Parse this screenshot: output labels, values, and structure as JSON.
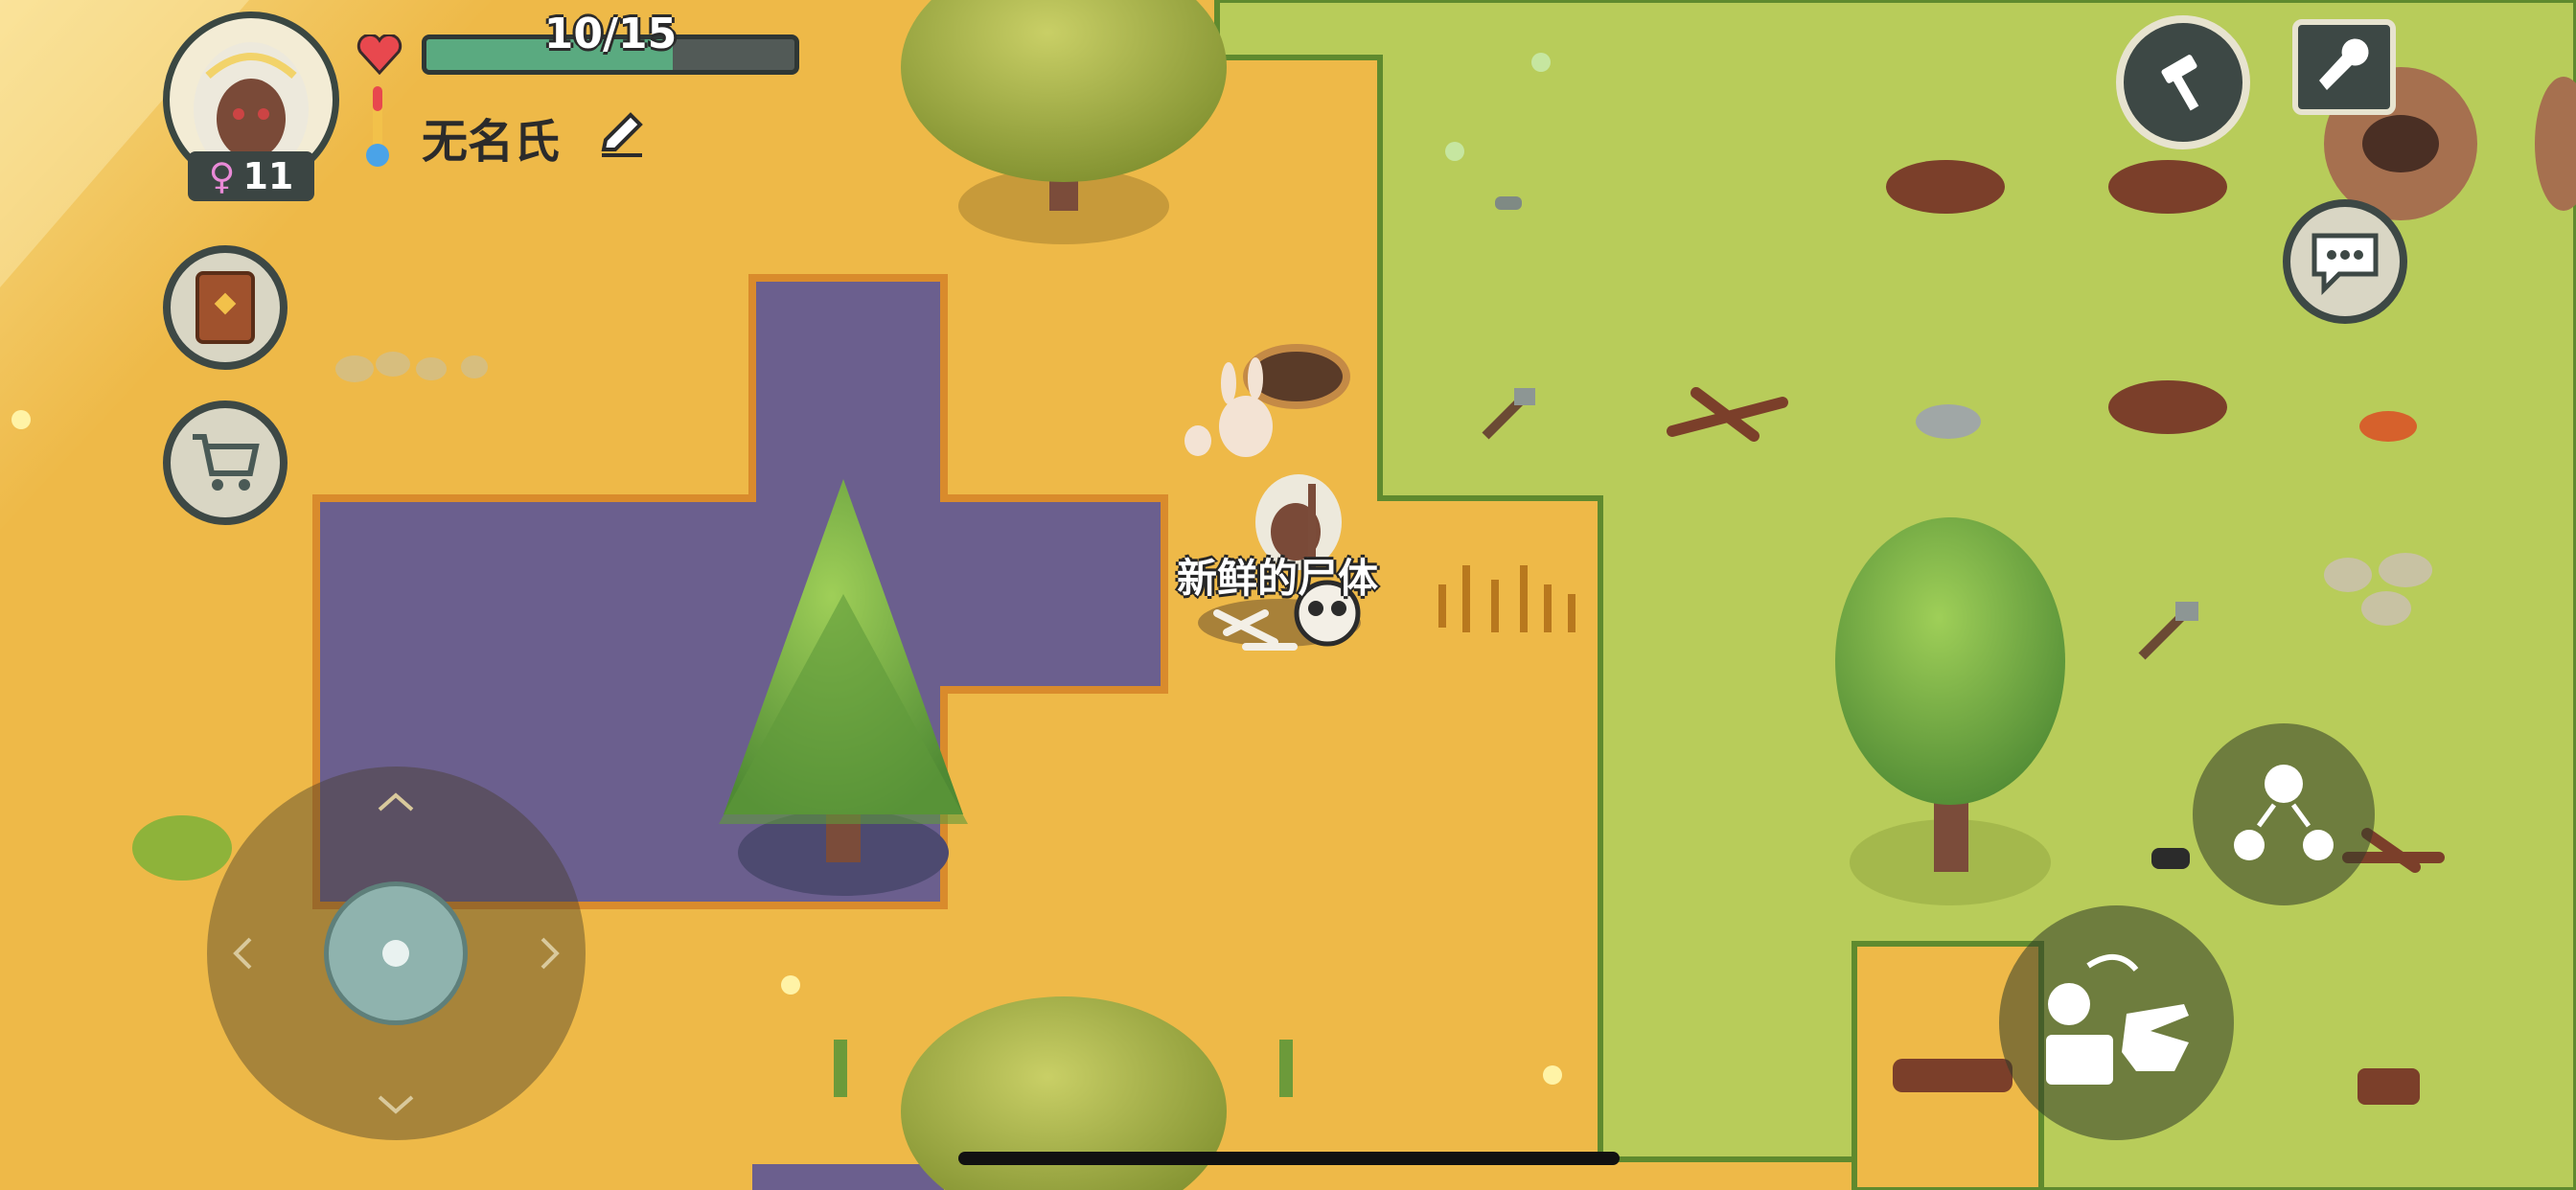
{
  "hud": {
    "health_text": "10/15",
    "health_fraction": 0.67,
    "player_name": "无名氏",
    "gender_symbol": "♀",
    "age": "11",
    "icons": {
      "heart": "heart-icon",
      "temperature": "thermometer-icon",
      "edit": "pencil-icon",
      "journal": "book-icon",
      "shop": "shopping-cart-icon",
      "craft": "hammer-icon",
      "settings": "wrench-icon",
      "chat": "speech-bubble-icon",
      "actions": "action-menu-icon",
      "interact": "hand-grab-icon"
    }
  },
  "world": {
    "corpse_label": "新鲜的尸体"
  },
  "colors": {
    "sand": "#eeb948",
    "grass": "#b8cc5a",
    "water": "#6b5f8e",
    "health": "#5aaa80"
  }
}
